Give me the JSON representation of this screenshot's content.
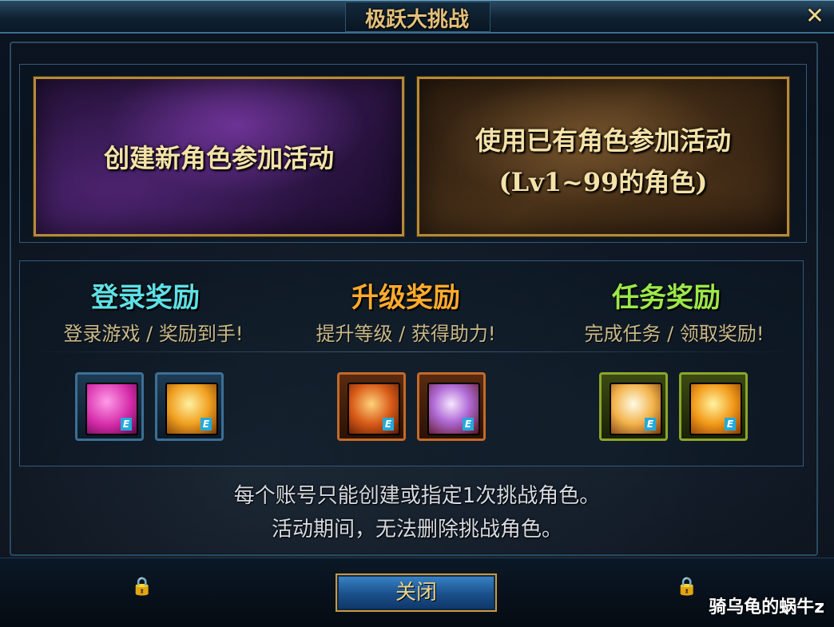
{
  "window": {
    "title": "极跃大挑战",
    "close_glyph": "✕"
  },
  "banners": {
    "create_new": {
      "label": "创建新角色参加活动"
    },
    "use_existing": {
      "label_line1": "使用已有角色参加活动",
      "label_line2": "(Lv1~99的角色)"
    }
  },
  "rewards": [
    {
      "title": "登录奖励",
      "subtitle": "登录游戏 / 奖励到手!",
      "title_color": "#5fe0e6",
      "frame": "blue",
      "items": [
        {
          "icon": "pink-gift-box-icon"
        },
        {
          "icon": "gold-box-icon"
        }
      ]
    },
    {
      "title": "升级奖励",
      "subtitle": "提升等级 / 获得助力!",
      "title_color": "#ffab2e",
      "frame": "orange",
      "items": [
        {
          "icon": "red-gold-chest-icon"
        },
        {
          "icon": "crystal-cube-icon"
        }
      ]
    },
    {
      "title": "任务奖励",
      "subtitle": "完成任务 / 领取奖励!",
      "title_color": "#9be84a",
      "frame": "green",
      "items": [
        {
          "icon": "white-gold-sack-icon"
        },
        {
          "icon": "gold-reward-icon"
        }
      ]
    }
  ],
  "item_badge": "E",
  "notice": {
    "line1": "每个账号只能创建或指定1次挑战角色。",
    "line2": "活动期间，无法删除挑战角色。"
  },
  "footer": {
    "close_button": "关闭",
    "watermark": "骑乌龟的蜗牛z"
  }
}
